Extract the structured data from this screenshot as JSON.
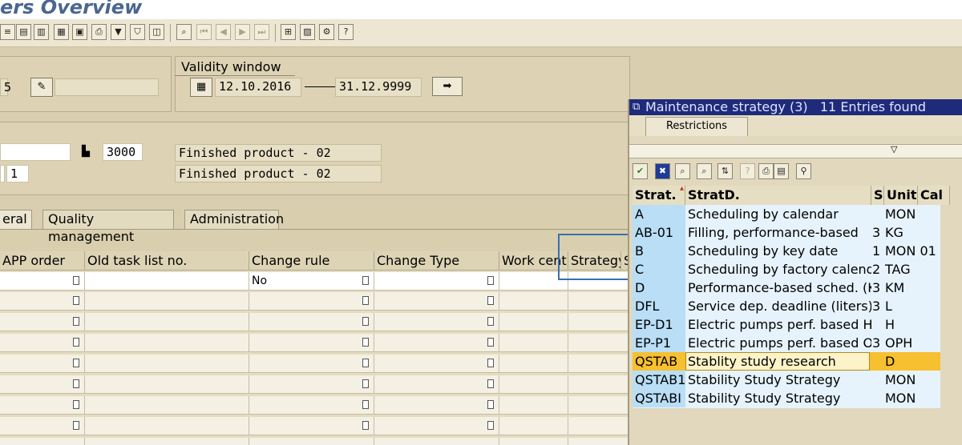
{
  "window": {
    "title": "ers Overview"
  },
  "toolbar": {
    "icons": [
      "list-icon",
      "list-detail-icon",
      "doc-icon",
      "select-icon",
      "add-row-icon",
      "print-icon",
      "filter-icon",
      "funnel-icon",
      "layout-icon",
      "find-icon",
      "first-page-icon",
      "prev-page-icon",
      "next-page-icon",
      "last-page-icon",
      "hierarchy-icon",
      "graphic-icon",
      "settings-icon",
      "help-icon"
    ]
  },
  "header": {
    "short_field": "5",
    "validity": {
      "title": "Validity window",
      "from": "12.10.2016",
      "to": "31.12.9999"
    },
    "plant": "3000",
    "counter": "1",
    "material_desc_1": "Finished product - 02",
    "material_desc_2": "Finished product - 02"
  },
  "tabs": [
    {
      "label": "eral"
    },
    {
      "label": "Quality management"
    },
    {
      "label": "Administration"
    }
  ],
  "table": {
    "columns": [
      "APP order",
      "Old task list no.",
      "Change rule",
      "Change Type",
      "Work cent...",
      "Strategy",
      "S"
    ],
    "first_row_change_rule": "No"
  },
  "popup": {
    "title": "Maintenance strategy (3)   11 Entries found",
    "tab": "Restrictions",
    "columns": [
      "Strat.",
      "StratD.",
      "S",
      "Unit",
      "Cal"
    ],
    "rows": [
      {
        "strat": "A",
        "desc": "Scheduling by calendar",
        "s": "",
        "unit": "MON"
      },
      {
        "strat": "AB-01",
        "desc": "Filling, performance-based",
        "s": "3",
        "unit": "KG"
      },
      {
        "strat": "B",
        "desc": "Scheduling by key date",
        "s": "1",
        "unit": "MON 01"
      },
      {
        "strat": "C",
        "desc": "Scheduling by factory calendar",
        "s": "2",
        "unit": "TAG"
      },
      {
        "strat": "D",
        "desc": "Performance-based sched. (KM)",
        "s": "3",
        "unit": "KM"
      },
      {
        "strat": "DFL",
        "desc": "Service dep. deadline (liters)",
        "s": "3",
        "unit": "L"
      },
      {
        "strat": "EP-D1",
        "desc": "Electric pumps perf. based H",
        "s": "",
        "unit": "H"
      },
      {
        "strat": "EP-P1",
        "desc": "Electric pumps perf. based OPH",
        "s": "3",
        "unit": "OPH"
      },
      {
        "strat": "QSTAB",
        "desc": "Stablity study research",
        "s": "",
        "unit": "D"
      },
      {
        "strat": "QSTAB1",
        "desc": "Stability Study Strategy",
        "s": "",
        "unit": "MON"
      },
      {
        "strat": "QSTABI",
        "desc": "Stability Study Strategy",
        "s": "",
        "unit": "MON"
      }
    ],
    "selected_index": 8,
    "colors": {
      "highlight": "#f7c030",
      "key_col": "#b9def5",
      "rows": "#e6f3fc",
      "title_bg": "#1e2a7a"
    }
  }
}
